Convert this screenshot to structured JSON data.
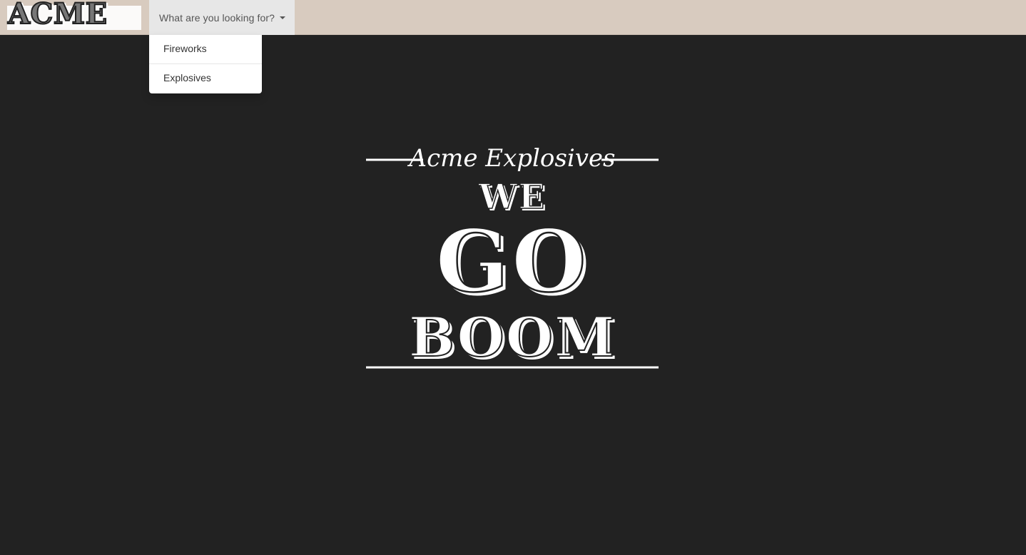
{
  "navbar": {
    "brand": "ACME",
    "dropdown_label": "What are you looking for?",
    "caret_icon": "caret-down-icon"
  },
  "dropdown_menu": {
    "items": [
      {
        "label": "Fireworks"
      },
      {
        "label": "Explosives"
      }
    ]
  },
  "hero": {
    "script_title": "Acme Explosives",
    "line1": "WE",
    "line2": "GO",
    "line3": "BOOM"
  },
  "colors": {
    "background": "#222222",
    "navbar": "#d8cbbf",
    "dropdown_active": "#e7e7e7",
    "hero_text": "#ffffff"
  }
}
